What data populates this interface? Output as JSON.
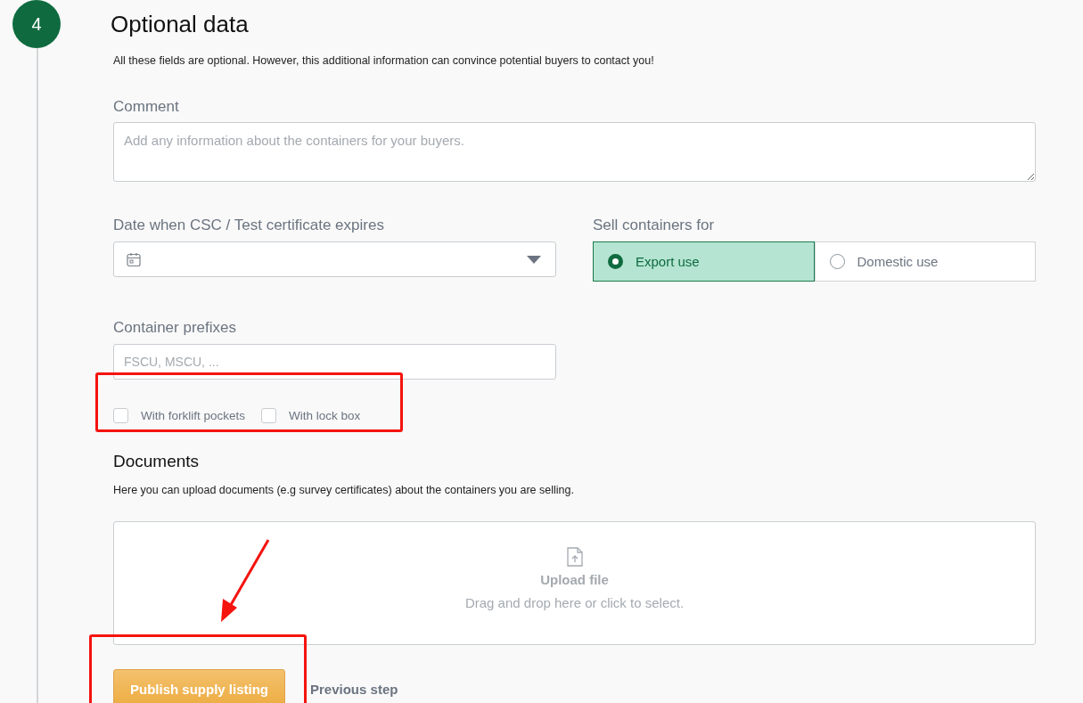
{
  "step": {
    "number": "4",
    "title": "Optional data",
    "description": "All these fields are optional. However, this additional information can convince potential buyers to contact you!"
  },
  "comment": {
    "label": "Comment",
    "placeholder": "Add any information about the containers for your buyers."
  },
  "expiry_date": {
    "label": "Date when CSC / Test certificate expires"
  },
  "sell_for": {
    "label": "Sell containers for",
    "options": [
      {
        "label": "Export use",
        "selected": true
      },
      {
        "label": "Domestic use",
        "selected": false
      }
    ]
  },
  "prefixes": {
    "label": "Container prefixes",
    "placeholder": "FSCU, MSCU, ..."
  },
  "features": [
    {
      "label": "With forklift pockets",
      "checked": false
    },
    {
      "label": "With lock box",
      "checked": false
    }
  ],
  "documents": {
    "title": "Documents",
    "description": "Here you can upload documents (e.g survey certificates) about the containers you are selling.",
    "upload_title": "Upload file",
    "upload_hint": "Drag and drop here or click to select."
  },
  "actions": {
    "primary": "Publish supply listing",
    "secondary": "Previous step"
  },
  "annotations": [
    {
      "kind": "frame"
    },
    {
      "kind": "frame"
    },
    {
      "kind": "arrow"
    }
  ]
}
